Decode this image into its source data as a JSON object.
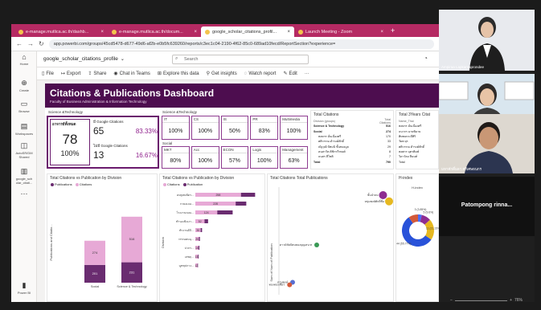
{
  "browser": {
    "tabs": [
      {
        "title": "e-manage.mutlica.ac.th/dashb...",
        "active": false
      },
      {
        "title": "e-manage.mutlica.ac.th/docum...",
        "active": false
      },
      {
        "title": "google_scholar_citations_profil...",
        "active": true
      },
      {
        "title": "Launch Meeting - Zoom",
        "active": false
      }
    ],
    "new_tab": "+",
    "url": "app.powerbi.com/groups/45cd5478-d677-49d6-af2b-e0b5fc639260/reports/c3ec1c04-2190-4f62-85c0-689ad10fecd/ReportSection?experience="
  },
  "powerbi": {
    "report_name": "google_scholar_citations_profile",
    "search_placeholder": "Search",
    "rail": [
      {
        "icon": "home-icon",
        "glyph": "⌂",
        "label": "Home"
      },
      {
        "icon": "create-icon",
        "glyph": "⊕",
        "label": "Create"
      },
      {
        "icon": "browse-icon",
        "glyph": "▭",
        "label": "Browse"
      },
      {
        "icon": "workspaces-icon",
        "glyph": "▤",
        "label": "Workspaces"
      },
      {
        "icon": "dataset-icon",
        "glyph": "◫",
        "label": "AutoSR/DM Shared"
      },
      {
        "icon": "report-icon",
        "glyph": "▥",
        "label": "google_sch olar_citati..."
      },
      {
        "icon": "more-icon",
        "glyph": "⋯",
        "label": ""
      },
      {
        "icon": "powerbi-icon",
        "glyph": "▮",
        "label": "Power BI"
      }
    ],
    "toolbar": [
      "File",
      "Export",
      "Share",
      "Chat in Teams",
      "Explore this data",
      "Get insights",
      "Watch report",
      "Edit",
      "···"
    ]
  },
  "dashboard": {
    "title": "Citations & Publications Dashboard",
    "subtitle": "Faculty of Business Administration & Information Technology",
    "left_card": {
      "section": "Science &Technology",
      "thai_label": "อาจารย์ทั้งหมด",
      "total": "78",
      "total_pct": "100%",
      "with_label": "มี Google Citations",
      "with_count": "65",
      "with_pct": "83.33%",
      "without_label": "ไม่มี Google Citations",
      "without_count": "13",
      "without_pct": "16.67%"
    },
    "sci_section": "Science &Technology",
    "sci_depts": [
      {
        "name": "IT",
        "value": "100%"
      },
      {
        "name": "CS",
        "value": "100%"
      },
      {
        "name": "IS",
        "value": "50%"
      },
      {
        "name": "PR",
        "value": "83%"
      },
      {
        "name": "Multimedia",
        "value": "100%"
      }
    ],
    "social_section": "Social",
    "social_depts": [
      {
        "name": "MKT",
        "value": "80%"
      },
      {
        "name": "Acc",
        "value": "100%"
      },
      {
        "name": "ECON",
        "value": "57%"
      },
      {
        "name": "Logis",
        "value": "100%"
      },
      {
        "name": "Management",
        "value": "63%"
      }
    ],
    "total_citations": {
      "title": "Total Citations",
      "col1": "Division (groups)",
      "col2": "Total Citations",
      "rows": [
        {
          "name": "Science & Technology",
          "value": "516",
          "bold": true
        },
        {
          "name": "Social",
          "value": "274",
          "bold": true
        },
        {
          "name": "พงษกร มั่นเนื่องศรี",
          "value": "170",
          "bold": false
        },
        {
          "name": "ศศิวรรณ ดำรงค์ศักดิ์",
          "value": "33",
          "bold": false
        },
        {
          "name": "ณัฐวุฒิ ปัทมนิ ชั้นทองมูล",
          "value": "29",
          "bold": false
        },
        {
          "name": "คนสาวิต ติชิกรวีรพงศ์",
          "value": "8",
          "bold": false
        },
        {
          "name": "ธนสร สีโชติ",
          "value": "7",
          "bold": false
        },
        {
          "name": "Total",
          "value": "790",
          "bold": true
        }
      ]
    },
    "top3": {
      "title": "Total 3Years Citat",
      "col": "Name_Thai",
      "rows": [
        "พงษกร มั่นเนื่องศรี",
        "ธนากร ฉายพิมาย",
        "ศิษทอกล ดีศิริ",
        "วัยพ ยุร",
        "ศศิวรรณ ดำรงค์ศักดิ์",
        "พงศกร บุตรพิมพ์",
        "วิลาวัลย สีนนท์",
        "Total"
      ]
    },
    "chart1": {
      "title": "Total Citations vs Publication by Division",
      "legend": [
        "Publications",
        "Citations"
      ]
    },
    "chart2": {
      "title": "Total Citations vs Publication by Division",
      "legend": [
        "Citations",
        "Publication"
      ]
    },
    "chart3": {
      "title": "Total Citations Total Publications"
    },
    "chart4": {
      "title": "H-index",
      "legend_label": "H-index"
    }
  },
  "chart_data": [
    {
      "type": "bar",
      "title": "Total Citations vs Publication by Division",
      "categories": [
        "Social",
        "Science & Technology"
      ],
      "series": [
        {
          "name": "Publications",
          "values": [
            201,
            231
          ]
        },
        {
          "name": "Citations",
          "values": [
            274,
            516
          ]
        }
      ],
      "xlabel": "",
      "ylabel": "Publications and Citatio..."
    },
    {
      "type": "bar",
      "title": "Total Citations vs Publication by Division",
      "categories": [
        "ดษฐสนพัดร...",
        "กวยอเจอ...",
        "โรงงานณณ...",
        "ทำนงเชิงเงา...",
        "ทำงานดิจิ...",
        "วรรณคนนุ...",
        "ปวกร...",
        "เสพฤ...",
        "บูทชุปกาง..."
      ],
      "series": [
        {
          "name": "Citations",
          "values": [
            258,
            228,
            124,
            52,
            30,
            20,
            18,
            15,
            12
          ]
        },
        {
          "name": "Publication",
          "values": [
            80,
            60,
            87,
            20,
            8,
            6,
            5,
            4,
            3
          ]
        }
      ],
      "ylabel": "Division"
    },
    {
      "type": "scatter",
      "title": "Total Citations Total Publications",
      "ylabel": "Sum of Num of Publication",
      "points": [
        {
          "label": "ชั้นนำลม",
          "x": 170,
          "y": 80
        },
        {
          "label": "หนุ่มพงษ์ศักดิ์ซื่อ",
          "x": 180,
          "y": 75
        },
        {
          "label": "ดาวน์ชัยปัตนทองบุญเสน ท",
          "x": 60,
          "y": 40
        },
        {
          "label": "ดาษพงษ์",
          "x": 20,
          "y": 10
        },
        {
          "label": "ทองทองเชียร",
          "x": 15,
          "y": 8
        }
      ]
    },
    {
      "type": "pie",
      "title": "H-index",
      "slices": [
        {
          "label": "3 (3.85%)",
          "value": 3.85
        },
        {
          "label": "5 (9.6%)",
          "value": 9.6
        },
        {
          "label": "11 (21.15%)",
          "value": 21.15
        },
        {
          "label": "44 (55.77%)",
          "value": 55.77
        },
        {
          "label": "other",
          "value": 9.63
        }
      ]
    }
  ],
  "participants": [
    {
      "name": "Ampiraa Lapkantaprondee"
    },
    {
      "name": "Sanaphon Ayuwaraskun"
    },
    {
      "name": "มหาศักดิ์มลา ศรีเศษธนกร"
    },
    {
      "name": "Patompong rinna..."
    }
  ],
  "status": {
    "zoom": "76%"
  }
}
